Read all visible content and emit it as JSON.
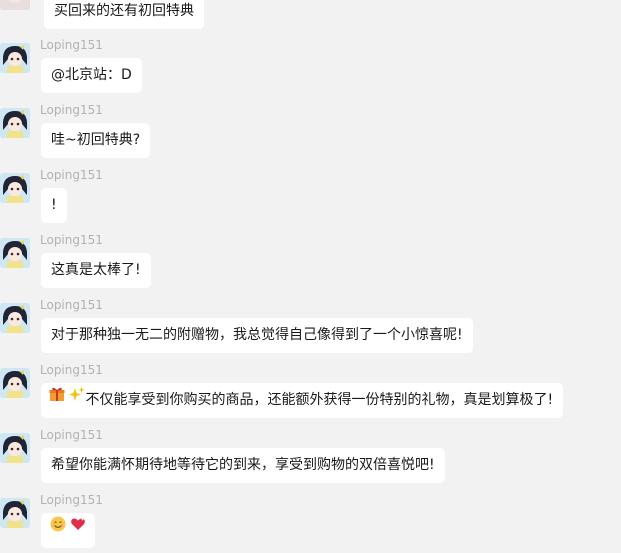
{
  "messages": [
    {
      "sender": "",
      "text": "买回来的还有初回特典"
    },
    {
      "sender": "Loping151",
      "text": "@北京站：D"
    },
    {
      "sender": "Loping151",
      "text": "哇~初回特典?"
    },
    {
      "sender": "Loping151",
      "text": "!"
    },
    {
      "sender": "Loping151",
      "text": "这真是太棒了!"
    },
    {
      "sender": "Loping151",
      "text": "对于那种独一无二的附赠物，我总觉得自己像得到了一个小惊喜呢!"
    },
    {
      "sender": "Loping151",
      "emojis": [
        "gift-icon",
        "sparkles-icon"
      ],
      "text": "不仅能享受到你购买的商品，还能额外获得一份特别的礼物，真是划算极了!"
    },
    {
      "sender": "Loping151",
      "text": "希望你能满怀期待地等待它的到来，享受到购物的双倍喜悦吧!"
    },
    {
      "sender": "Loping151",
      "emojis": [
        "smiling-face-icon",
        "sparkling-heart-icon"
      ],
      "text": ""
    }
  ],
  "colors": {
    "background": "#f2f2f2",
    "bubble": "#ffffff",
    "sender_name": "#b2b2b2",
    "text": "#191919"
  }
}
